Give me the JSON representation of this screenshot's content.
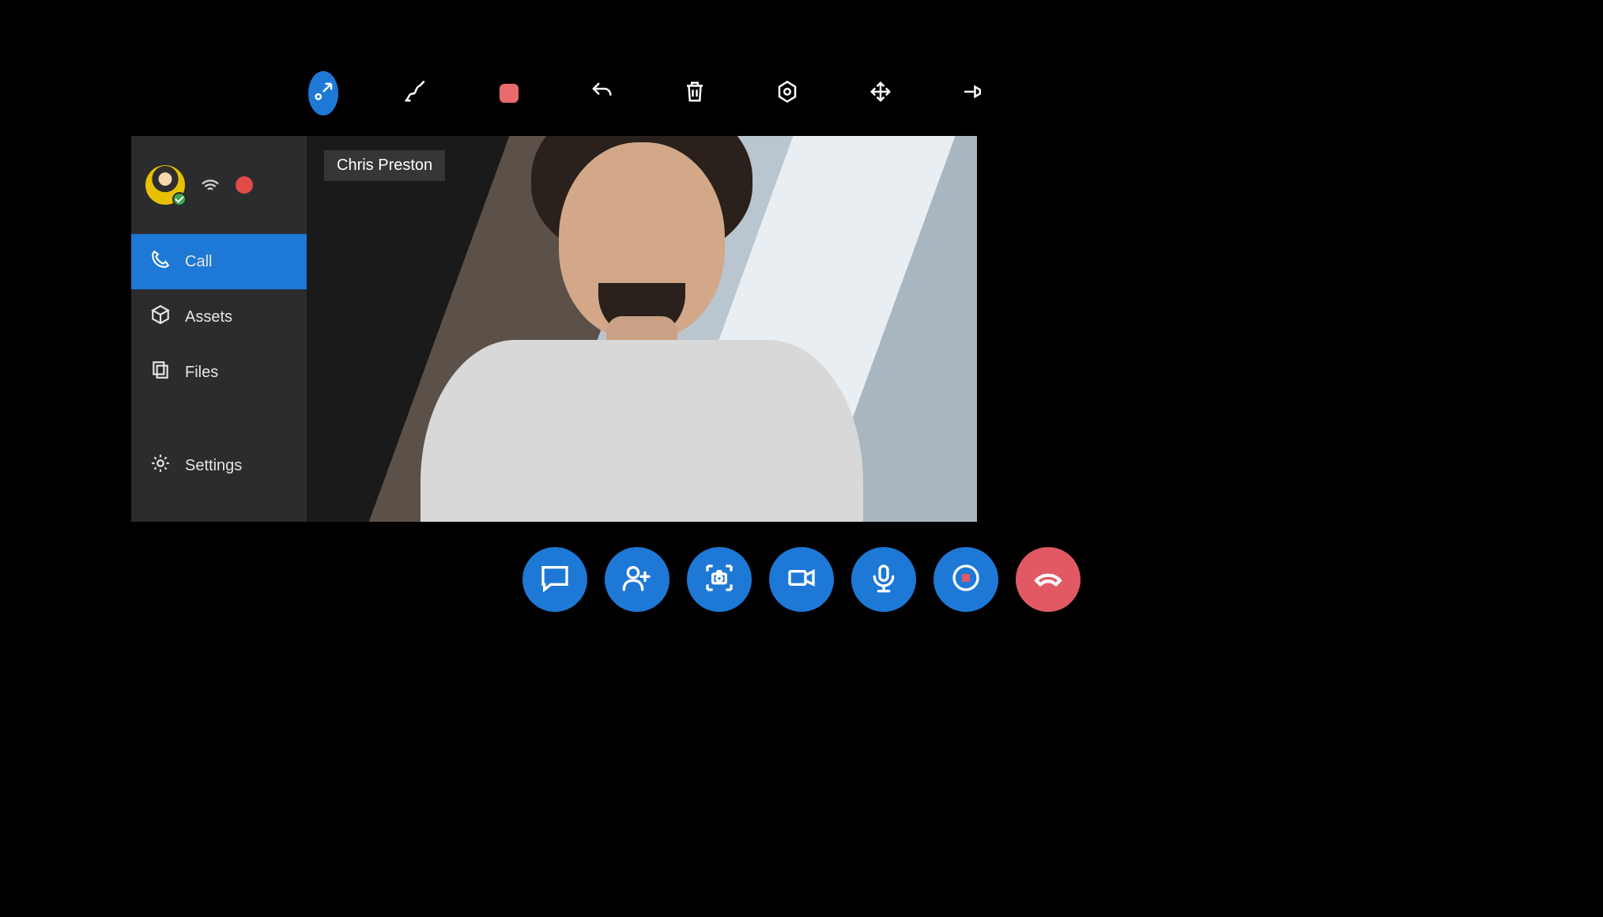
{
  "colors": {
    "accent": "#1e78d6",
    "danger": "#e15a63",
    "record": "#e34b4b"
  },
  "toolbar": {
    "items": [
      {
        "name": "collapse-button",
        "icon": "collapse-icon",
        "active": true
      },
      {
        "name": "ink-button",
        "icon": "ink-icon"
      },
      {
        "name": "stop-annotation-button",
        "icon": "stop-square-icon"
      },
      {
        "name": "undo-button",
        "icon": "undo-icon"
      },
      {
        "name": "delete-button",
        "icon": "trash-icon"
      },
      {
        "name": "focus-button",
        "icon": "target-icon"
      },
      {
        "name": "move-button",
        "icon": "move-arrows-icon"
      },
      {
        "name": "pin-button",
        "icon": "pin-icon"
      }
    ]
  },
  "sidebar": {
    "user": {
      "presence": "available"
    },
    "recording_indicator": true,
    "items": [
      {
        "label": "Call",
        "icon": "phone-icon",
        "active": true
      },
      {
        "label": "Assets",
        "icon": "box-icon",
        "active": false
      },
      {
        "label": "Files",
        "icon": "files-icon",
        "active": false
      },
      {
        "label": "Settings",
        "icon": "gear-icon",
        "active": false,
        "position": "bottom"
      }
    ]
  },
  "call": {
    "remote_participant_name": "Chris Preston"
  },
  "controls": {
    "items": [
      {
        "name": "chat-button",
        "icon": "chat-icon"
      },
      {
        "name": "add-participant-button",
        "icon": "add-person-icon"
      },
      {
        "name": "snapshot-button",
        "icon": "camera-capture-icon"
      },
      {
        "name": "toggle-video-button",
        "icon": "video-icon"
      },
      {
        "name": "toggle-mic-button",
        "icon": "mic-icon"
      },
      {
        "name": "record-button",
        "icon": "record-icon"
      },
      {
        "name": "end-call-button",
        "icon": "hangup-icon",
        "style": "end"
      }
    ]
  }
}
